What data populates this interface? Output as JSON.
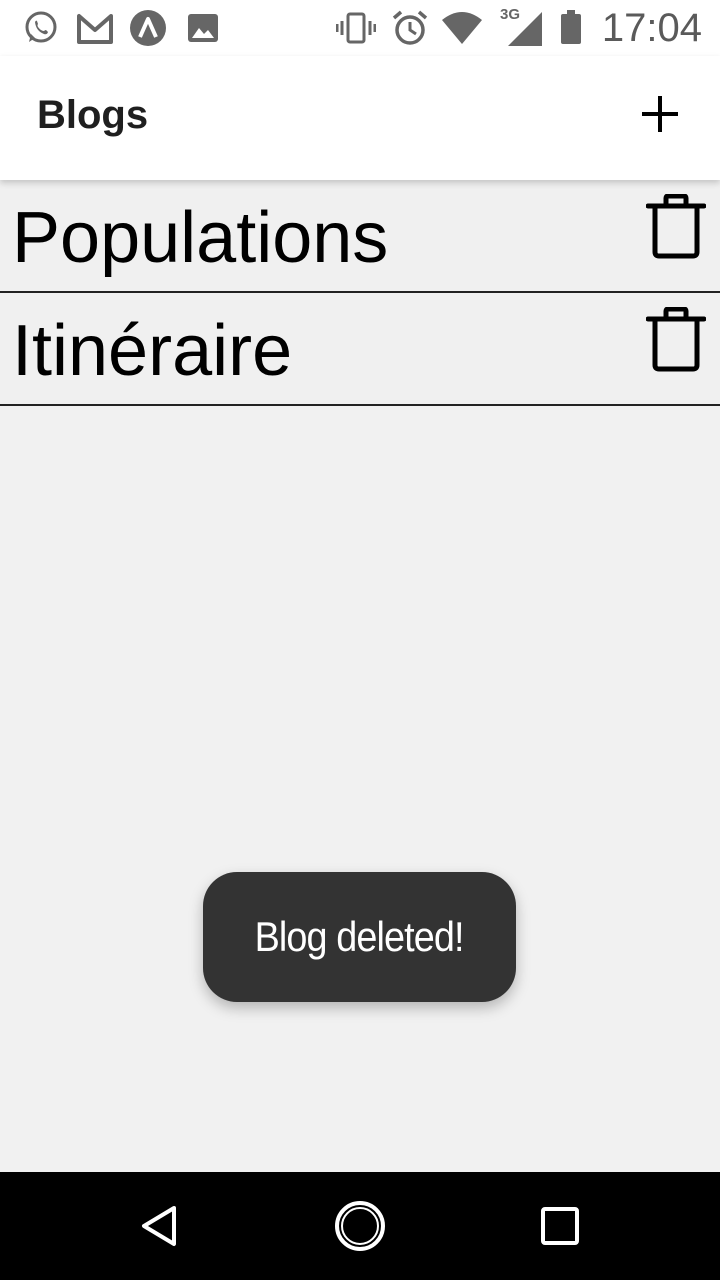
{
  "status_bar": {
    "time": "17:04",
    "network_type": "3G",
    "icons": [
      "whatsapp-icon",
      "gmail-icon",
      "app-icon",
      "image-icon",
      "vibrate-icon",
      "alarm-icon",
      "wifi-icon",
      "signal-icon",
      "battery-icon"
    ]
  },
  "app_bar": {
    "title": "Blogs",
    "add_icon": "plus-icon"
  },
  "blogs": [
    {
      "title": "Populations",
      "action_icon": "trash-icon"
    },
    {
      "title": "Itinéraire",
      "action_icon": "trash-icon"
    }
  ],
  "toast": {
    "message": "Blog deleted!"
  },
  "nav_bar": {
    "buttons": [
      "back-icon",
      "home-icon",
      "recents-icon"
    ]
  },
  "colors": {
    "background": "#f1f1f1",
    "app_bar": "#ffffff",
    "toast_bg": "#333333",
    "nav_bar": "#000000",
    "status_icons": "#5a5a5a"
  }
}
